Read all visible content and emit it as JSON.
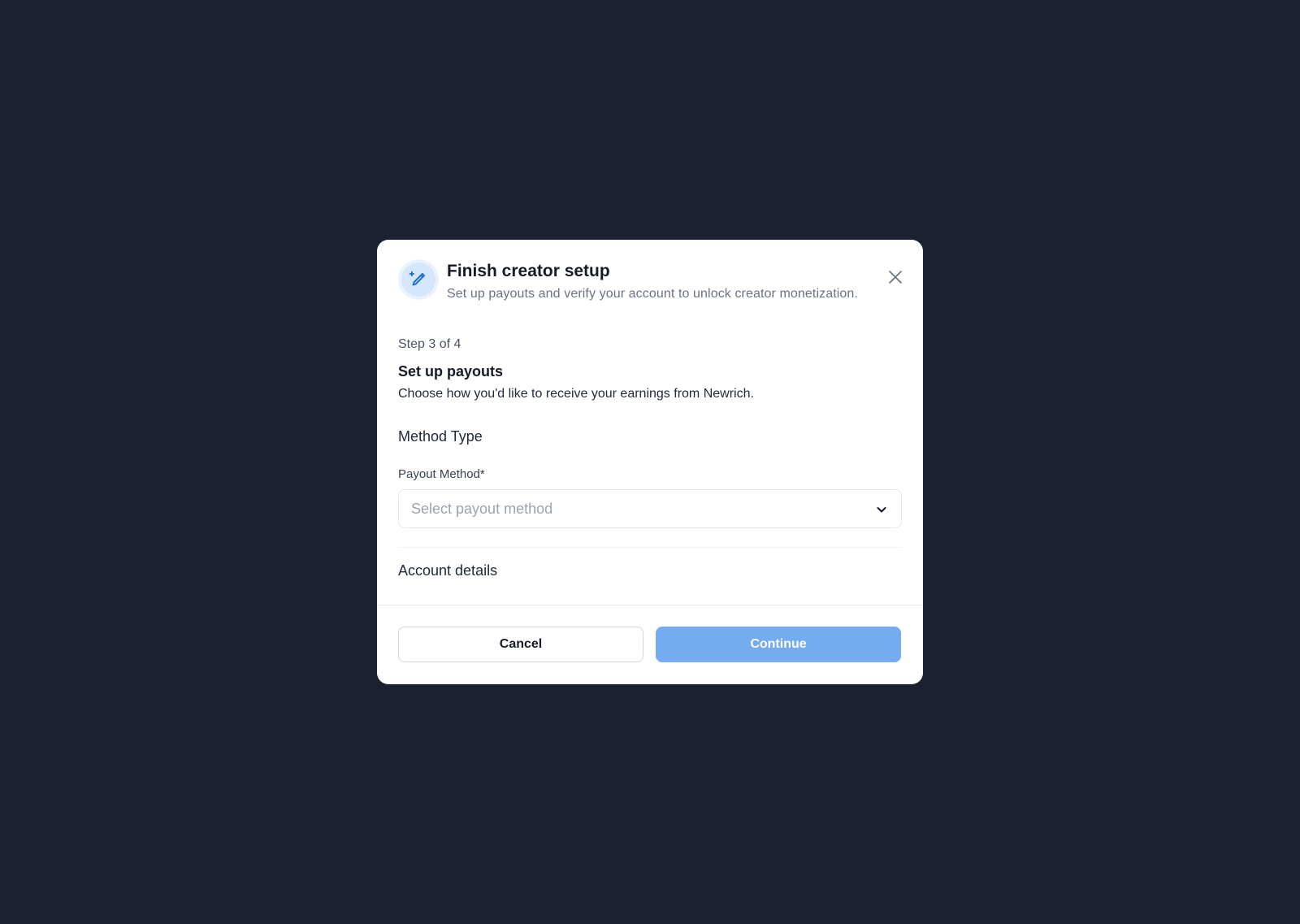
{
  "modal": {
    "title": "Finish creator setup",
    "subtitle": "Set up payouts and verify your account to unlock creator monetization.",
    "header_icon": "pencil-sparkle-icon",
    "close_icon": "close-icon"
  },
  "step": {
    "label": "Step 3 of 4",
    "title": "Set up payouts",
    "description": "Choose how you'd like to receive your earnings from Newrich."
  },
  "form": {
    "method_type_heading": "Method Type",
    "payout_method_label": "Payout Method*",
    "payout_method_placeholder": "Select payout method",
    "account_details_heading": "Account details"
  },
  "footer": {
    "cancel_label": "Cancel",
    "continue_label": "Continue"
  },
  "colors": {
    "backdrop": "#1b2130",
    "accent": "#75abf0",
    "icon_blue": "#1d6fd1"
  }
}
